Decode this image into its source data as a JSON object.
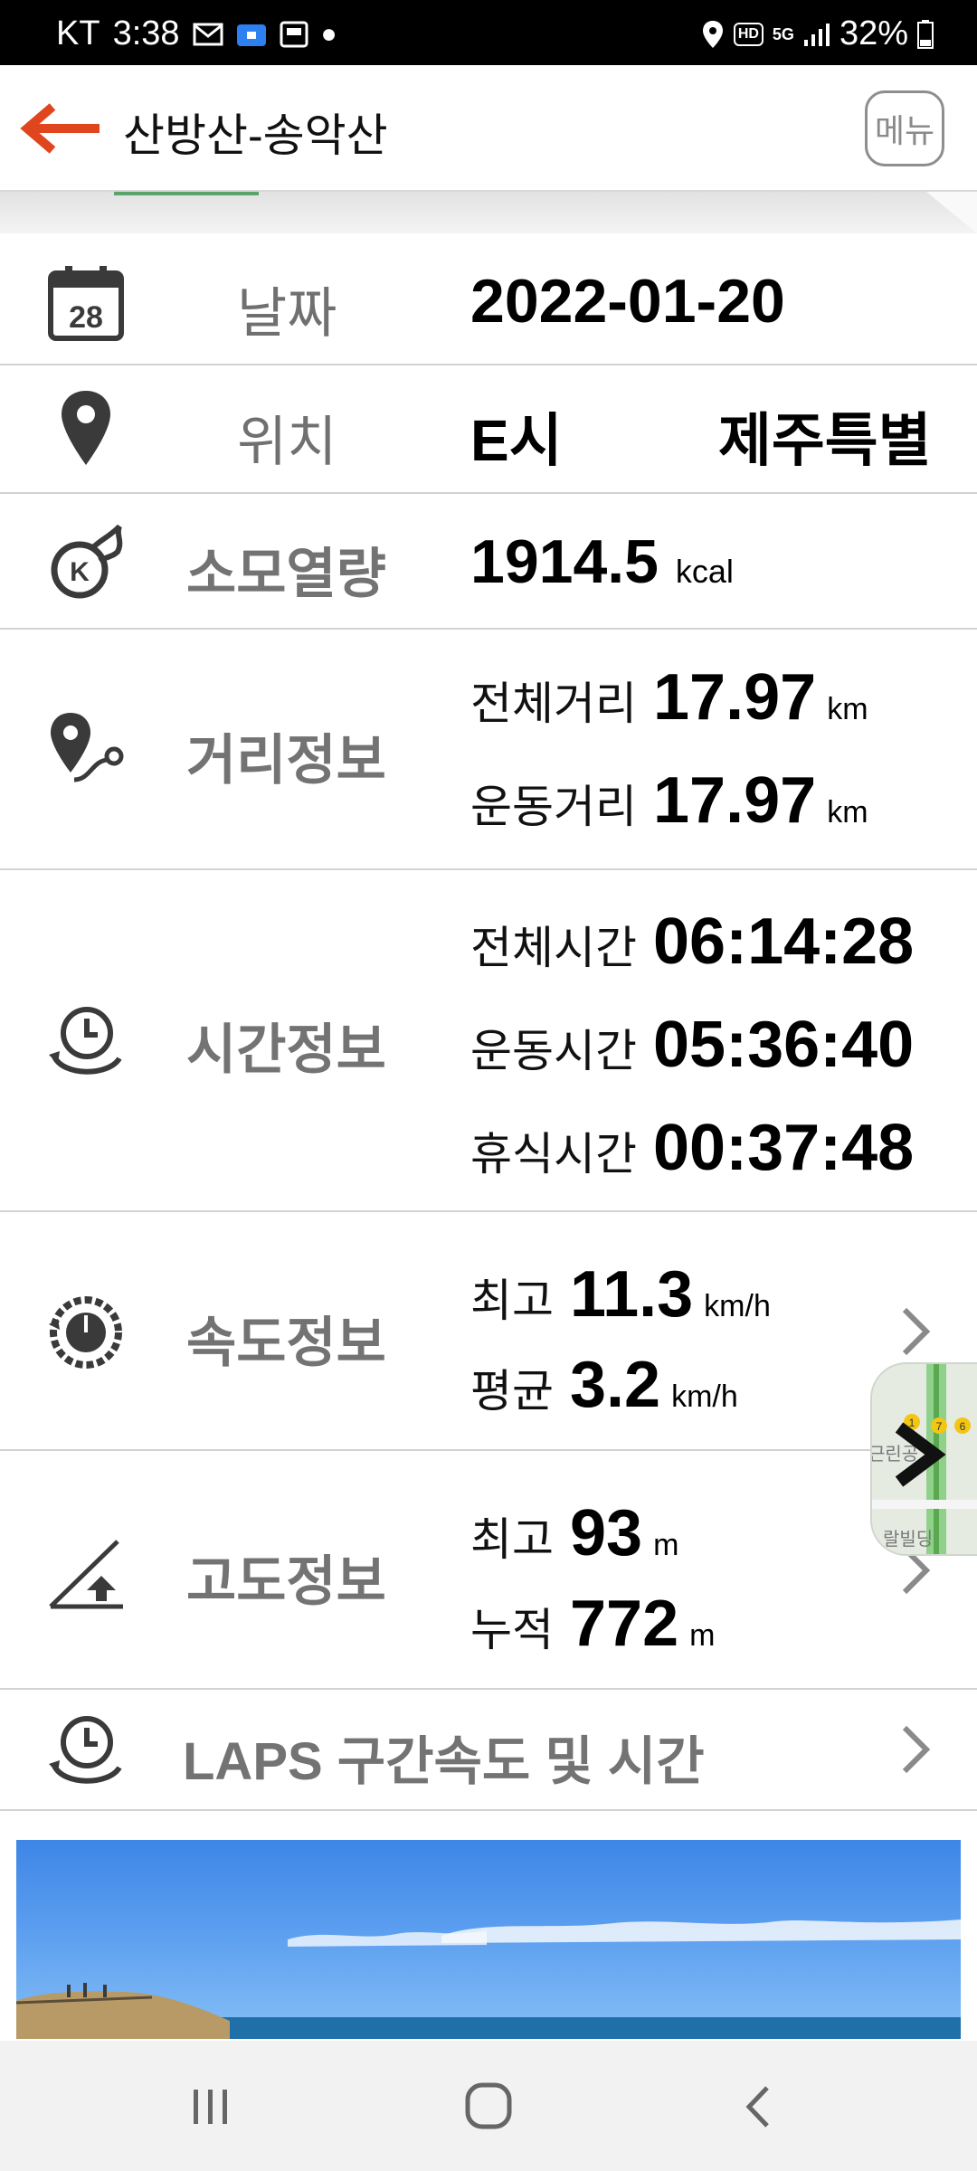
{
  "status_bar": {
    "carrier": "KT",
    "time": "3:38",
    "battery": "32%",
    "hd": "HD",
    "network": "5G"
  },
  "app_bar": {
    "title": "산방산-송악산",
    "menu_label": "메뉴"
  },
  "rows": {
    "date": {
      "label": "날짜",
      "value": "2022-01-20",
      "icon_day": "28"
    },
    "location": {
      "label": "위치",
      "value_a": "E시",
      "value_b": "제주특별"
    },
    "calories": {
      "label": "소모열량",
      "value": "1914.5",
      "unit": "kcal"
    },
    "distance": {
      "label": "거리정보",
      "total_label": "전체거리",
      "total_value": "17.97",
      "total_unit": "km",
      "moving_label": "운동거리",
      "moving_value": "17.97",
      "moving_unit": "km"
    },
    "time": {
      "label": "시간정보",
      "total_label": "전체시간",
      "total_value": "06:14:28",
      "moving_label": "운동시간",
      "moving_value": "05:36:40",
      "rest_label": "휴식시간",
      "rest_value": "00:37:48"
    },
    "speed": {
      "label": "속도정보",
      "max_label": "최고",
      "max_value": "11.3",
      "max_unit": "km/h",
      "avg_label": "평균",
      "avg_value": "3.2",
      "avg_unit": "km/h"
    },
    "altitude": {
      "label": "고도정보",
      "max_label": "최고",
      "max_value": "93",
      "max_unit": "m",
      "cum_label": "누적",
      "cum_value": "772",
      "cum_unit": "m"
    },
    "laps": {
      "label": "LAPS 구간속도 및 시간"
    }
  },
  "map_thumb": {
    "text_a": "근린공",
    "text_b": "랄빌딩",
    "badges": [
      "1",
      "7",
      "6"
    ]
  },
  "colors": {
    "accent_back": "#e0461e",
    "label_gray": "#737373",
    "divider": "#d2d2d2"
  },
  "icons": [
    "calendar-icon",
    "location-pin-icon",
    "calorie-flame-icon",
    "route-icon",
    "clock-icon",
    "speedometer-icon",
    "altitude-icon",
    "chevron-right-icon",
    "back-arrow-icon"
  ]
}
